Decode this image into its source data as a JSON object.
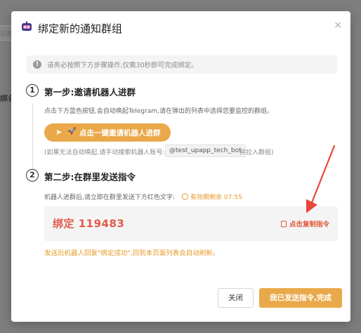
{
  "background": {
    "input_placeholder": "日期",
    "side_label": "绑名"
  },
  "modal": {
    "title": "绑定新的通知群组",
    "close_symbol": "×",
    "info": "请务必按照下方步骤操作,仅需30秒即可完成绑定。",
    "step1": {
      "number": "1",
      "title": "第一步:邀请机器人进群",
      "desc": "点击下方蓝色按钮,会自动唤起Telegram,请在弹出的列表中选择您要监控的群组。",
      "button_label": "点击一键邀请机器人进群",
      "manual_prefix": "(如果无法自动唤起,请手动搜索机器人账号:",
      "bot_handle": "@test_upapp_tech_bot",
      "manual_suffix": "并拉入群组)"
    },
    "step2": {
      "number": "2",
      "title": "第二步:在群里发送指令",
      "desc": "机器人进群后,请立即在群里发送下方红色文字:",
      "timer_label": "有效期剩余 07:55",
      "command": "绑定 119483",
      "copy_label": "点击复制指令",
      "after_note": "发送后机器人回复\"绑定成功\",回到本页面列表会自动刷新。"
    },
    "footer": {
      "close_label": "关闭",
      "done_label": "我已发送指令,完成"
    }
  },
  "colors": {
    "accent": "#e9a94a",
    "command_red": "#e35a4a",
    "arrow_red": "#e8453c",
    "timer_orange": "#e69a28"
  },
  "icons": [
    "robot-icon",
    "info-icon",
    "send-icon",
    "rocket-icon",
    "clock-icon",
    "copy-icon",
    "close-icon"
  ]
}
